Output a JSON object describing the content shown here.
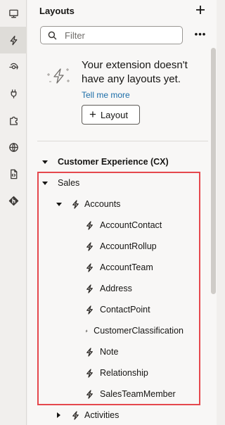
{
  "rail": {
    "items": [
      {
        "icon": "monitor-icon",
        "active": false
      },
      {
        "icon": "lightning-icon",
        "active": true
      },
      {
        "icon": "workflow-icon",
        "active": false
      },
      {
        "icon": "plug-icon",
        "active": false
      },
      {
        "icon": "puzzle-icon",
        "active": false
      },
      {
        "icon": "globe-icon",
        "active": false
      },
      {
        "icon": "code-file-icon",
        "active": false
      },
      {
        "icon": "git-icon",
        "active": false
      }
    ]
  },
  "panel": {
    "title": "Layouts",
    "search_placeholder": "Filter",
    "empty_message": "Your extension doesn't have any layouts yet.",
    "tell_me_more": "Tell me more",
    "layout_button": "Layout"
  },
  "tree": {
    "root": "Customer Experience (CX)",
    "sales": "Sales",
    "accounts": "Accounts",
    "account_children": [
      "AccountContact",
      "AccountRollup",
      "AccountTeam",
      "Address",
      "ContactPoint",
      "CustomerClassification",
      "Note",
      "Relationship",
      "SalesTeamMember"
    ],
    "activities": "Activities"
  }
}
